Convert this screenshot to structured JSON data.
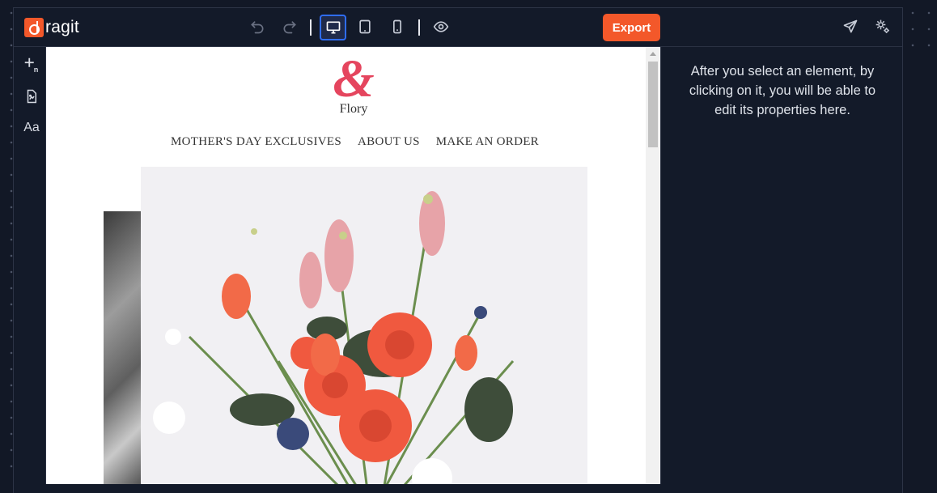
{
  "app": {
    "name": "ragit"
  },
  "toolbar": {
    "export_label": "Export",
    "icons": [
      "undo-icon",
      "redo-icon",
      "desktop-icon",
      "tablet-icon",
      "mobile-icon",
      "eye-icon",
      "send-icon",
      "settings-icon"
    ],
    "active_device": "desktop"
  },
  "sidebar": {
    "items": [
      {
        "icon": "add-block-icon",
        "label": "+n"
      },
      {
        "icon": "document-image-icon",
        "label": ""
      },
      {
        "icon": "typography-icon",
        "label": "Aa"
      }
    ]
  },
  "canvas": {
    "brand": {
      "symbol": "&",
      "name": "Flory"
    },
    "nav": [
      "MOTHER'S DAY EXCLUSIVES",
      "ABOUT US",
      "MAKE AN ORDER"
    ]
  },
  "properties_panel": {
    "hint": "After you select an element, by clicking on it, you will be able to edit its properties here."
  },
  "colors": {
    "accent": "#f3582a",
    "active_border": "#2f6df6",
    "bg": "#121826",
    "brand_red": "#e5455e"
  }
}
